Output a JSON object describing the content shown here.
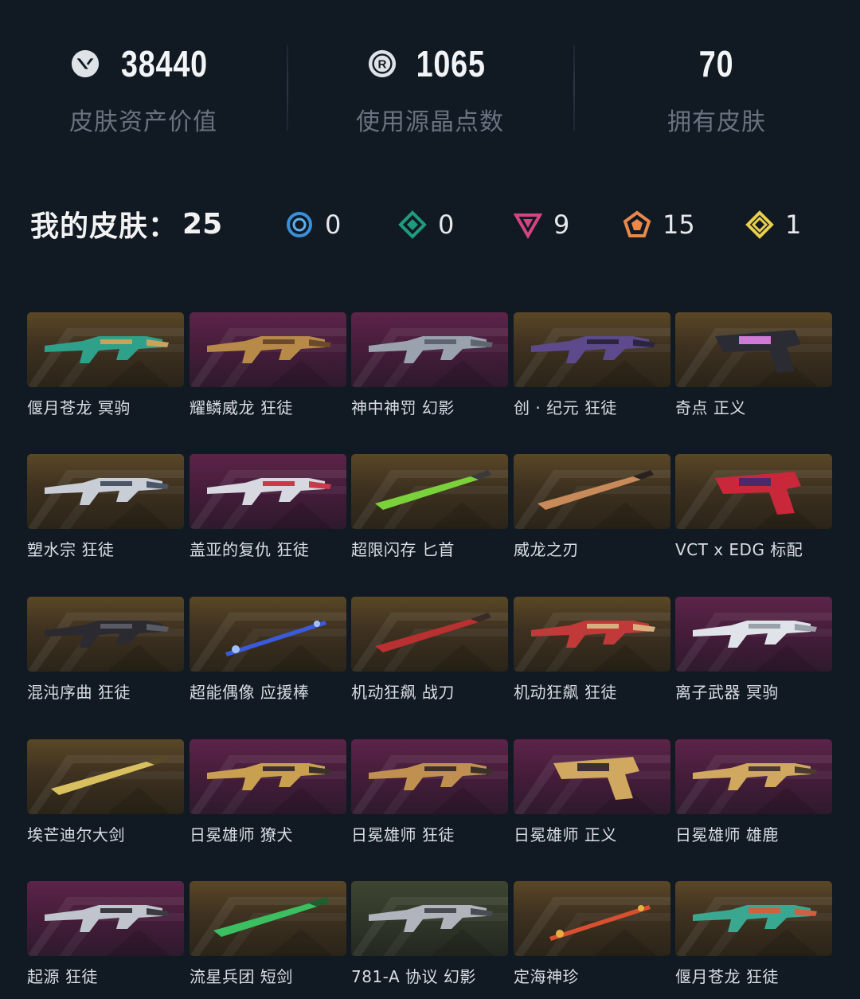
{
  "stats": [
    {
      "icon": "valorant-logo-icon",
      "value": "38440",
      "label": "皮肤资产价值"
    },
    {
      "icon": "radianite-points-icon",
      "value": "1065",
      "label": "使用源晶点数"
    },
    {
      "icon": "",
      "value": "70",
      "label": "拥有皮肤"
    }
  ],
  "summary": {
    "title": "我的皮肤：",
    "count": "25"
  },
  "tiers": [
    {
      "icon": "select-tier-icon",
      "color": "#3a8fd6",
      "count": "0"
    },
    {
      "icon": "deluxe-tier-icon",
      "color": "#1f9c7d",
      "count": "0"
    },
    {
      "icon": "premium-tier-icon",
      "color": "#d2457f",
      "count": "9"
    },
    {
      "icon": "exclusive-tier-icon",
      "color": "#e8894a",
      "count": "15"
    },
    {
      "icon": "ultra-tier-icon",
      "color": "#e8cf4c",
      "count": "1"
    }
  ],
  "skins": [
    {
      "name": "偃月苍龙 冥驹",
      "bg": "gold",
      "weapon": "rifle-teal"
    },
    {
      "name": "耀鳞威龙 狂徒",
      "bg": "purple",
      "weapon": "rifle-gold"
    },
    {
      "name": "神中神罚 幻影",
      "bg": "purple",
      "weapon": "rifle-grey"
    },
    {
      "name": "创 · 纪元 狂徒",
      "bg": "gold",
      "weapon": "rifle-purple"
    },
    {
      "name": "奇点 正义",
      "bg": "gold",
      "weapon": "revolver-dark"
    },
    {
      "name": "塑水宗 狂徒",
      "bg": "gold",
      "weapon": "rifle-silver"
    },
    {
      "name": "盖亚的复仇 狂徒",
      "bg": "purple",
      "weapon": "rifle-red"
    },
    {
      "name": "超限闪存 匕首",
      "bg": "gold",
      "weapon": "knife-green"
    },
    {
      "name": "威龙之刃",
      "bg": "gold",
      "weapon": "blade-copper"
    },
    {
      "name": "VCT x EDG 标配",
      "bg": "gold",
      "weapon": "pistol-red"
    },
    {
      "name": "混沌序曲 狂徒",
      "bg": "gold",
      "weapon": "rifle-black"
    },
    {
      "name": "超能偶像 应援棒",
      "bg": "gold",
      "weapon": "stick-blue"
    },
    {
      "name": "机动狂飙 战刀",
      "bg": "gold",
      "weapon": "sword-red"
    },
    {
      "name": "机动狂飙 狂徒",
      "bg": "gold",
      "weapon": "rifle-crimson"
    },
    {
      "name": "离子武器 冥驹",
      "bg": "purple",
      "weapon": "sniper-white"
    },
    {
      "name": "埃芒迪尔大剑",
      "bg": "gold",
      "weapon": "greatsword-gold"
    },
    {
      "name": "日冕雄师 獠犬",
      "bg": "purple",
      "weapon": "smg-gold"
    },
    {
      "name": "日冕雄师 狂徒",
      "bg": "purple",
      "weapon": "rifle-bronze"
    },
    {
      "name": "日冕雄师 正义",
      "bg": "purple",
      "weapon": "revolver-gold"
    },
    {
      "name": "日冕雄师 雄鹿",
      "bg": "purple",
      "weapon": "shotgun-gold"
    },
    {
      "name": "起源 狂徒",
      "bg": "purple",
      "weapon": "rifle-origin"
    },
    {
      "name": "流星兵团 短剑",
      "bg": "gold",
      "weapon": "dagger-green"
    },
    {
      "name": "781-A 协议 幻影",
      "bg": "green",
      "weapon": "rifle-protocol"
    },
    {
      "name": "定海神珍",
      "bg": "gold",
      "weapon": "staff-red"
    },
    {
      "name": "偃月苍龙 狂徒",
      "bg": "gold",
      "weapon": "rifle-jade"
    }
  ]
}
